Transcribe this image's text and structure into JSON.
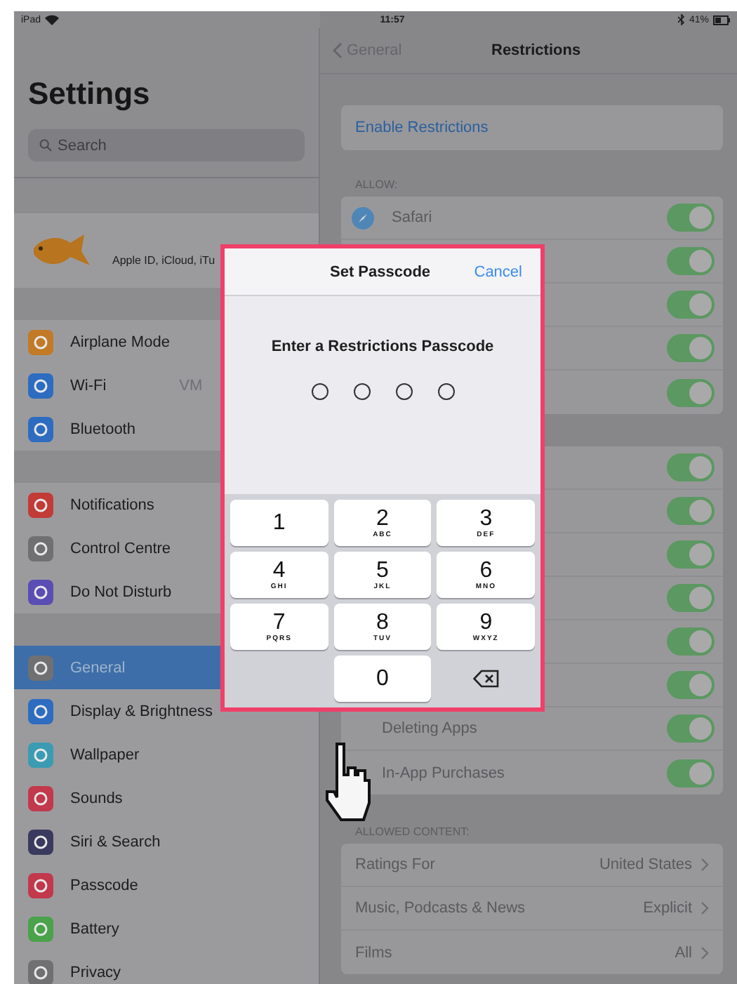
{
  "status_bar": {
    "device": "iPad",
    "time": "11:57",
    "battery": "41%"
  },
  "sidebar": {
    "title": "Settings",
    "search": {
      "placeholder": "Search"
    },
    "profile": {
      "subtitle": "Apple ID, iCloud, iTu"
    },
    "groups": [
      [
        {
          "label": "Airplane Mode",
          "color": "#c27a26",
          "selected": false
        },
        {
          "label": "Wi-Fi",
          "value": "VM",
          "color": "#2d6cc0",
          "selected": false
        },
        {
          "label": "Bluetooth",
          "color": "#2d6cc0",
          "selected": false
        }
      ],
      [
        {
          "label": "Notifications",
          "color": "#c23b36",
          "selected": false
        },
        {
          "label": "Control Centre",
          "color": "#707073",
          "selected": false
        },
        {
          "label": "Do Not Disturb",
          "color": "#5a4db3",
          "selected": false
        }
      ],
      [
        {
          "label": "General",
          "color": "#707073",
          "selected": true
        },
        {
          "label": "Display & Brightness",
          "color": "#2d6cc0",
          "selected": false
        },
        {
          "label": "Wallpaper",
          "color": "#3b9bb3",
          "selected": false
        },
        {
          "label": "Sounds",
          "color": "#c2384c",
          "selected": false
        },
        {
          "label": "Siri & Search",
          "color": "#3a3a5e",
          "selected": false
        },
        {
          "label": "Passcode",
          "color": "#c2384c",
          "selected": false
        },
        {
          "label": "Battery",
          "color": "#4aa24a",
          "selected": false
        },
        {
          "label": "Privacy",
          "color": "#707073",
          "selected": false
        }
      ]
    ]
  },
  "detail": {
    "back": "General",
    "title": "Restrictions",
    "enable": "Enable Restrictions",
    "allow_header": "ALLOW:",
    "allow_group_1": [
      {
        "label": "Safari",
        "on": true
      },
      {
        "on": true
      },
      {
        "on": true
      },
      {
        "on": true
      },
      {
        "on": true
      }
    ],
    "allow_group_2": [
      {
        "on": true
      },
      {
        "on": true
      },
      {
        "on": true
      },
      {
        "on": true
      },
      {
        "on": true
      },
      {
        "on": true
      },
      {
        "label": "Deleting Apps",
        "on": true
      },
      {
        "label": "In-App Purchases",
        "on": true
      }
    ],
    "content_header": "ALLOWED CONTENT:",
    "content_rows": [
      {
        "label": "Ratings For",
        "value": "United States"
      },
      {
        "label": "Music, Podcasts & News",
        "value": "Explicit"
      },
      {
        "label": "Films",
        "value": "All"
      }
    ]
  },
  "dialog": {
    "title": "Set Passcode",
    "cancel": "Cancel",
    "prompt": "Enter a Restrictions Passcode",
    "dots": [
      {
        "filled": false
      },
      {
        "filled": false
      },
      {
        "filled": false
      },
      {
        "filled": false
      }
    ],
    "keys": [
      {
        "kind": "digit",
        "digit": "1"
      },
      {
        "kind": "digit",
        "digit": "2",
        "letters": "ABC"
      },
      {
        "kind": "digit",
        "digit": "3",
        "letters": "DEF"
      },
      {
        "kind": "digit",
        "digit": "4",
        "letters": "GHI"
      },
      {
        "kind": "digit",
        "digit": "5",
        "letters": "JKL"
      },
      {
        "kind": "digit",
        "digit": "6",
        "letters": "MNO"
      },
      {
        "kind": "digit",
        "digit": "7",
        "letters": "PQRS"
      },
      {
        "kind": "digit",
        "digit": "8",
        "letters": "TUV"
      },
      {
        "kind": "digit",
        "digit": "9",
        "letters": "WXYZ"
      },
      {
        "kind": "blank"
      },
      {
        "kind": "digit",
        "digit": "0"
      },
      {
        "kind": "delete"
      }
    ]
  }
}
